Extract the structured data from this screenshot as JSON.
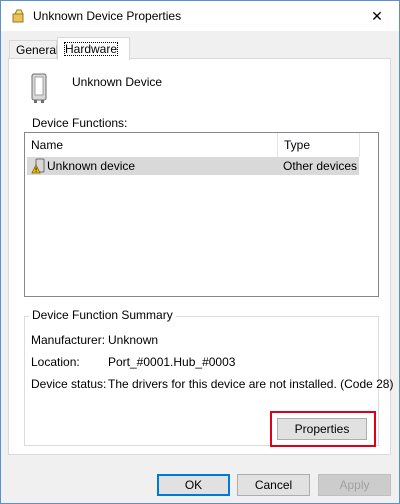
{
  "window": {
    "title": "Unknown Device Properties",
    "close_glyph": "✕"
  },
  "tabs": [
    {
      "label": "General",
      "active": false
    },
    {
      "label": "Hardware",
      "active": true
    }
  ],
  "device": {
    "name": "Unknown Device",
    "icon": "generic-device-icon"
  },
  "functions": {
    "label": "Device Functions:",
    "columns": [
      "Name",
      "Type"
    ],
    "rows": [
      {
        "name": "Unknown device",
        "type": "Other devices",
        "icon": "warning-device-icon",
        "selected": true
      }
    ]
  },
  "summary": {
    "title": "Device Function Summary",
    "manufacturer_label": "Manufacturer:",
    "manufacturer_value": "Unknown",
    "location_label": "Location:",
    "location_value": "Port_#0001.Hub_#0003",
    "status_label": "Device status:",
    "status_value": "The drivers for this device are not installed. (Code 28)",
    "properties_button": "Properties"
  },
  "footer": {
    "ok": "OK",
    "cancel": "Cancel",
    "apply": "Apply"
  },
  "colors": {
    "highlight": "#e0001b",
    "selection": "#d9d9d9",
    "window_border": "#5a8fd0"
  }
}
